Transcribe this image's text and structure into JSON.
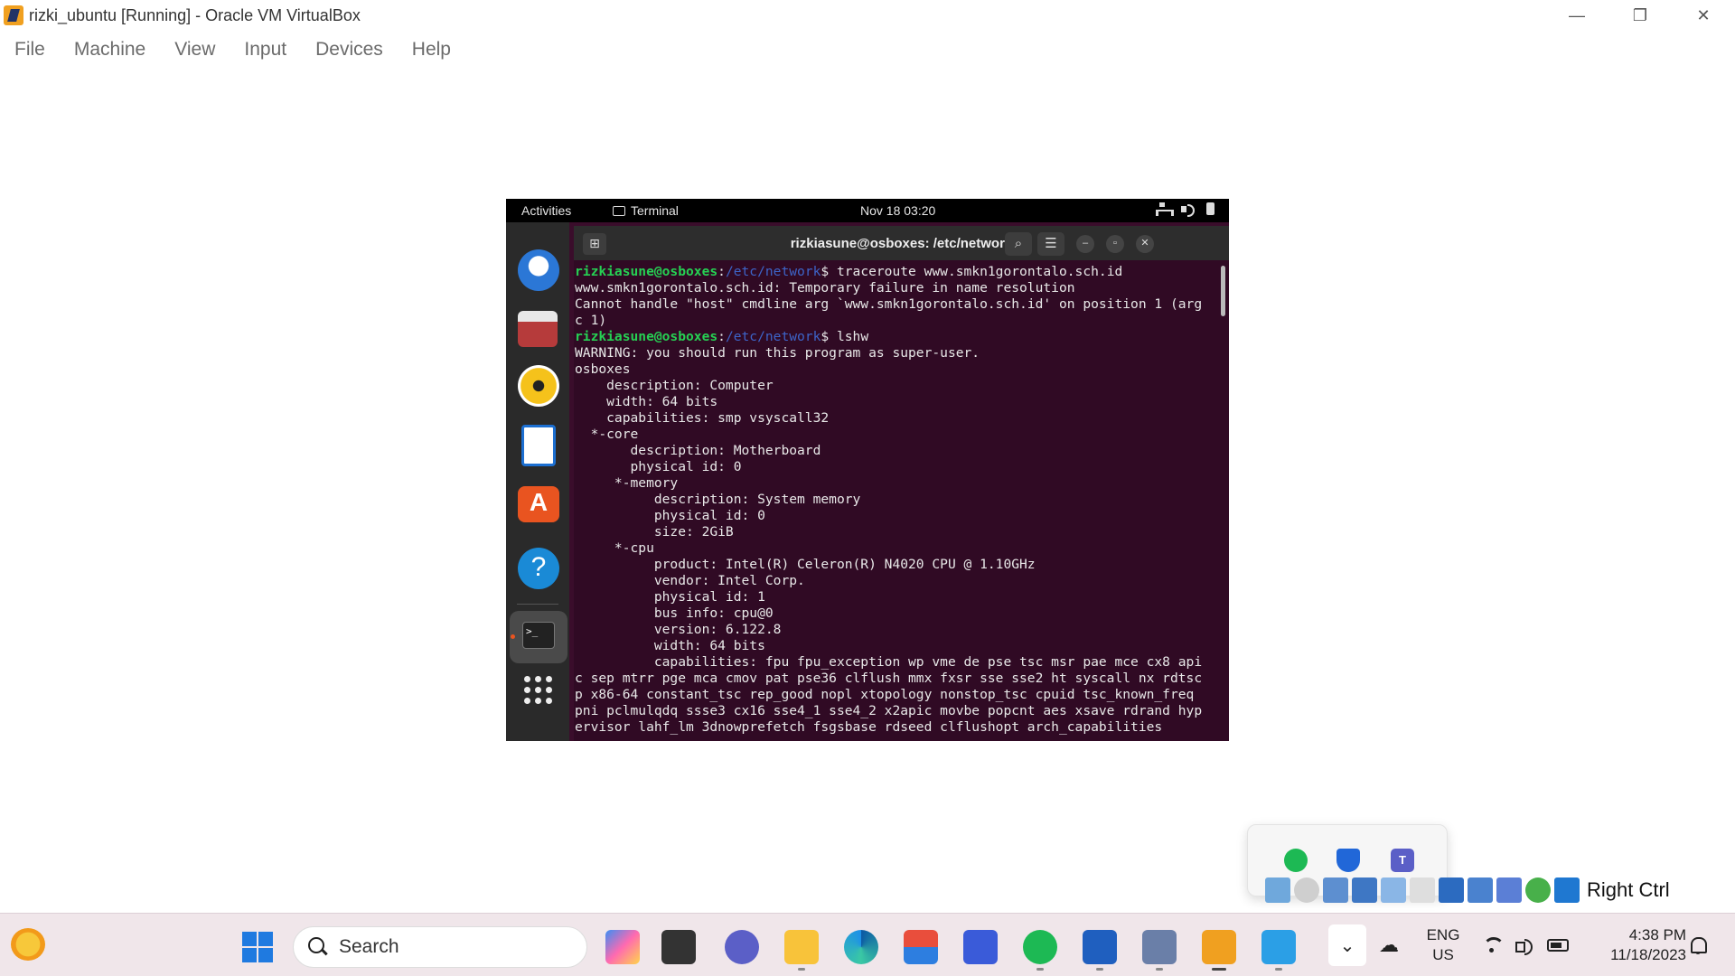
{
  "window": {
    "title": "rizki_ubuntu [Running] - Oracle VM VirtualBox",
    "controls": {
      "minimize": "—",
      "restore": "❐",
      "close": "✕"
    }
  },
  "menu": [
    "File",
    "Machine",
    "View",
    "Input",
    "Devices",
    "Help"
  ],
  "vm": {
    "topbar": {
      "activities": "Activities",
      "app": "Terminal",
      "clock": "Nov 18  03:20"
    },
    "dock": [
      "thunderbird-icon",
      "files-icon",
      "rhythmbox-icon",
      "writer-icon",
      "app-center-icon",
      "help-icon",
      "terminal-icon",
      "show-apps-icon"
    ],
    "terminal": {
      "title": "rizkiasune@osboxes: /etc/network",
      "buttons": {
        "search": "⌕",
        "menu": "☰",
        "minimize": "–",
        "maximize": "▫",
        "close": "✕"
      },
      "prompt_user": "rizkiasune@osboxes",
      "prompt_path": "/etc/network",
      "cmd1": "$ traceroute www.smkn1gorontalo.sch.id",
      "out1": [
        "www.smkn1gorontalo.sch.id: Temporary failure in name resolution",
        "Cannot handle \"host\" cmdline arg `www.smkn1gorontalo.sch.id' on position 1 (arg",
        "c 1)"
      ],
      "cmd2": "$ lshw",
      "out2": [
        "WARNING: you should run this program as super-user.",
        "osboxes",
        "    description: Computer",
        "    width: 64 bits",
        "    capabilities: smp vsyscall32",
        "  *-core",
        "       description: Motherboard",
        "       physical id: 0",
        "     *-memory",
        "          description: System memory",
        "          physical id: 0",
        "          size: 2GiB",
        "     *-cpu",
        "          product: Intel(R) Celeron(R) N4020 CPU @ 1.10GHz",
        "          vendor: Intel Corp.",
        "          physical id: 1",
        "          bus info: cpu@0",
        "          version: 6.122.8",
        "          width: 64 bits",
        "          capabilities: fpu fpu_exception wp vme de pse tsc msr pae mce cx8 api",
        "c sep mtrr pge mca cmov pat pse36 clflush mmx fxsr sse sse2 ht syscall nx rdtsc",
        "p x86-64 constant_tsc rep_good nopl xtopology nonstop_tsc cpuid tsc_known_freq",
        "pni pclmulqdq ssse3 cx16 sse4_1 sse4_2 x2apic movbe popcnt aes xsave rdrand hyp",
        "ervisor lahf_lm 3dnowprefetch fsgsbase rdseed clflushopt arch_capabilities"
      ]
    }
  },
  "tray_overflow": [
    "spotify-icon",
    "defender-warning-icon",
    "teams-icon"
  ],
  "host_key": "Right Ctrl",
  "taskbar": {
    "search_placeholder": "Search",
    "apps": [
      "copilot-icon",
      "terminal-window-icon",
      "meet-icon",
      "file-explorer-icon",
      "edge-icon",
      "store-icon",
      "vs-icon",
      "spotify-icon",
      "word-icon",
      "virtualbox-icon",
      "vm-icon",
      "photos-icon"
    ],
    "lang_top": "ENG",
    "lang_bottom": "US",
    "time": "4:38 PM",
    "date": "11/18/2023"
  }
}
